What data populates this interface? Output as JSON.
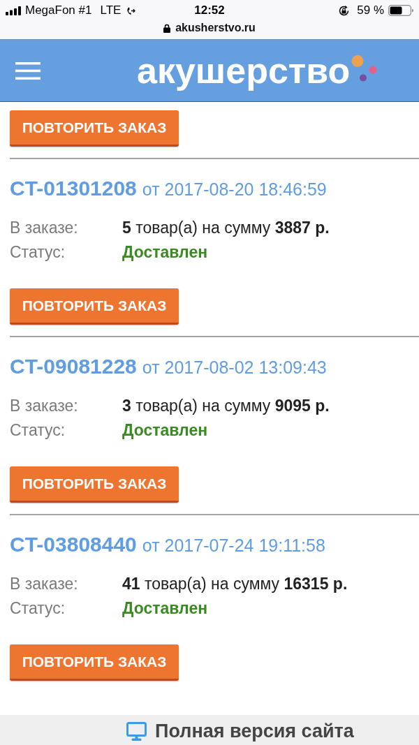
{
  "status_bar": {
    "carrier": "MegaFon #1",
    "network": "LTE",
    "time": "12:52",
    "battery_percent": "59 %",
    "url": "akusherstvo.ru"
  },
  "header": {
    "logo": "акушерство"
  },
  "previous_order": {
    "repeat_button": "ПОВТОРИТЬ ЗАКАЗ"
  },
  "orders": [
    {
      "number": "CT-01301208",
      "date": "от 2017-08-20 18:46:59",
      "items_label": "В заказе:",
      "items_summary": "**5** товар(а) на сумму **3887 р.**",
      "status_label": "Статус:",
      "status": "Доставлен",
      "repeat_button": "ПОВТОРИТЬ ЗАКАЗ"
    },
    {
      "number": "CT-09081228",
      "date": "от 2017-08-02 13:09:43",
      "items_label": "В заказе:",
      "items_summary": "**3** товар(а) на сумму **9095 р.**",
      "status_label": "Статус:",
      "status": "Доставлен",
      "repeat_button": "ПОВТОРИТЬ ЗАКАЗ"
    },
    {
      "number": "CT-03808440",
      "date": "от 2017-07-24 19:11:58",
      "items_label": "В заказе:",
      "items_summary": "**41** товар(а) на сумму **16315 р.**",
      "status_label": "Статус:",
      "status": "Доставлен",
      "repeat_button": "ПОВТОРИТЬ ЗАКАЗ"
    }
  ],
  "footer": {
    "full_version_link": "Полная версия сайта"
  }
}
